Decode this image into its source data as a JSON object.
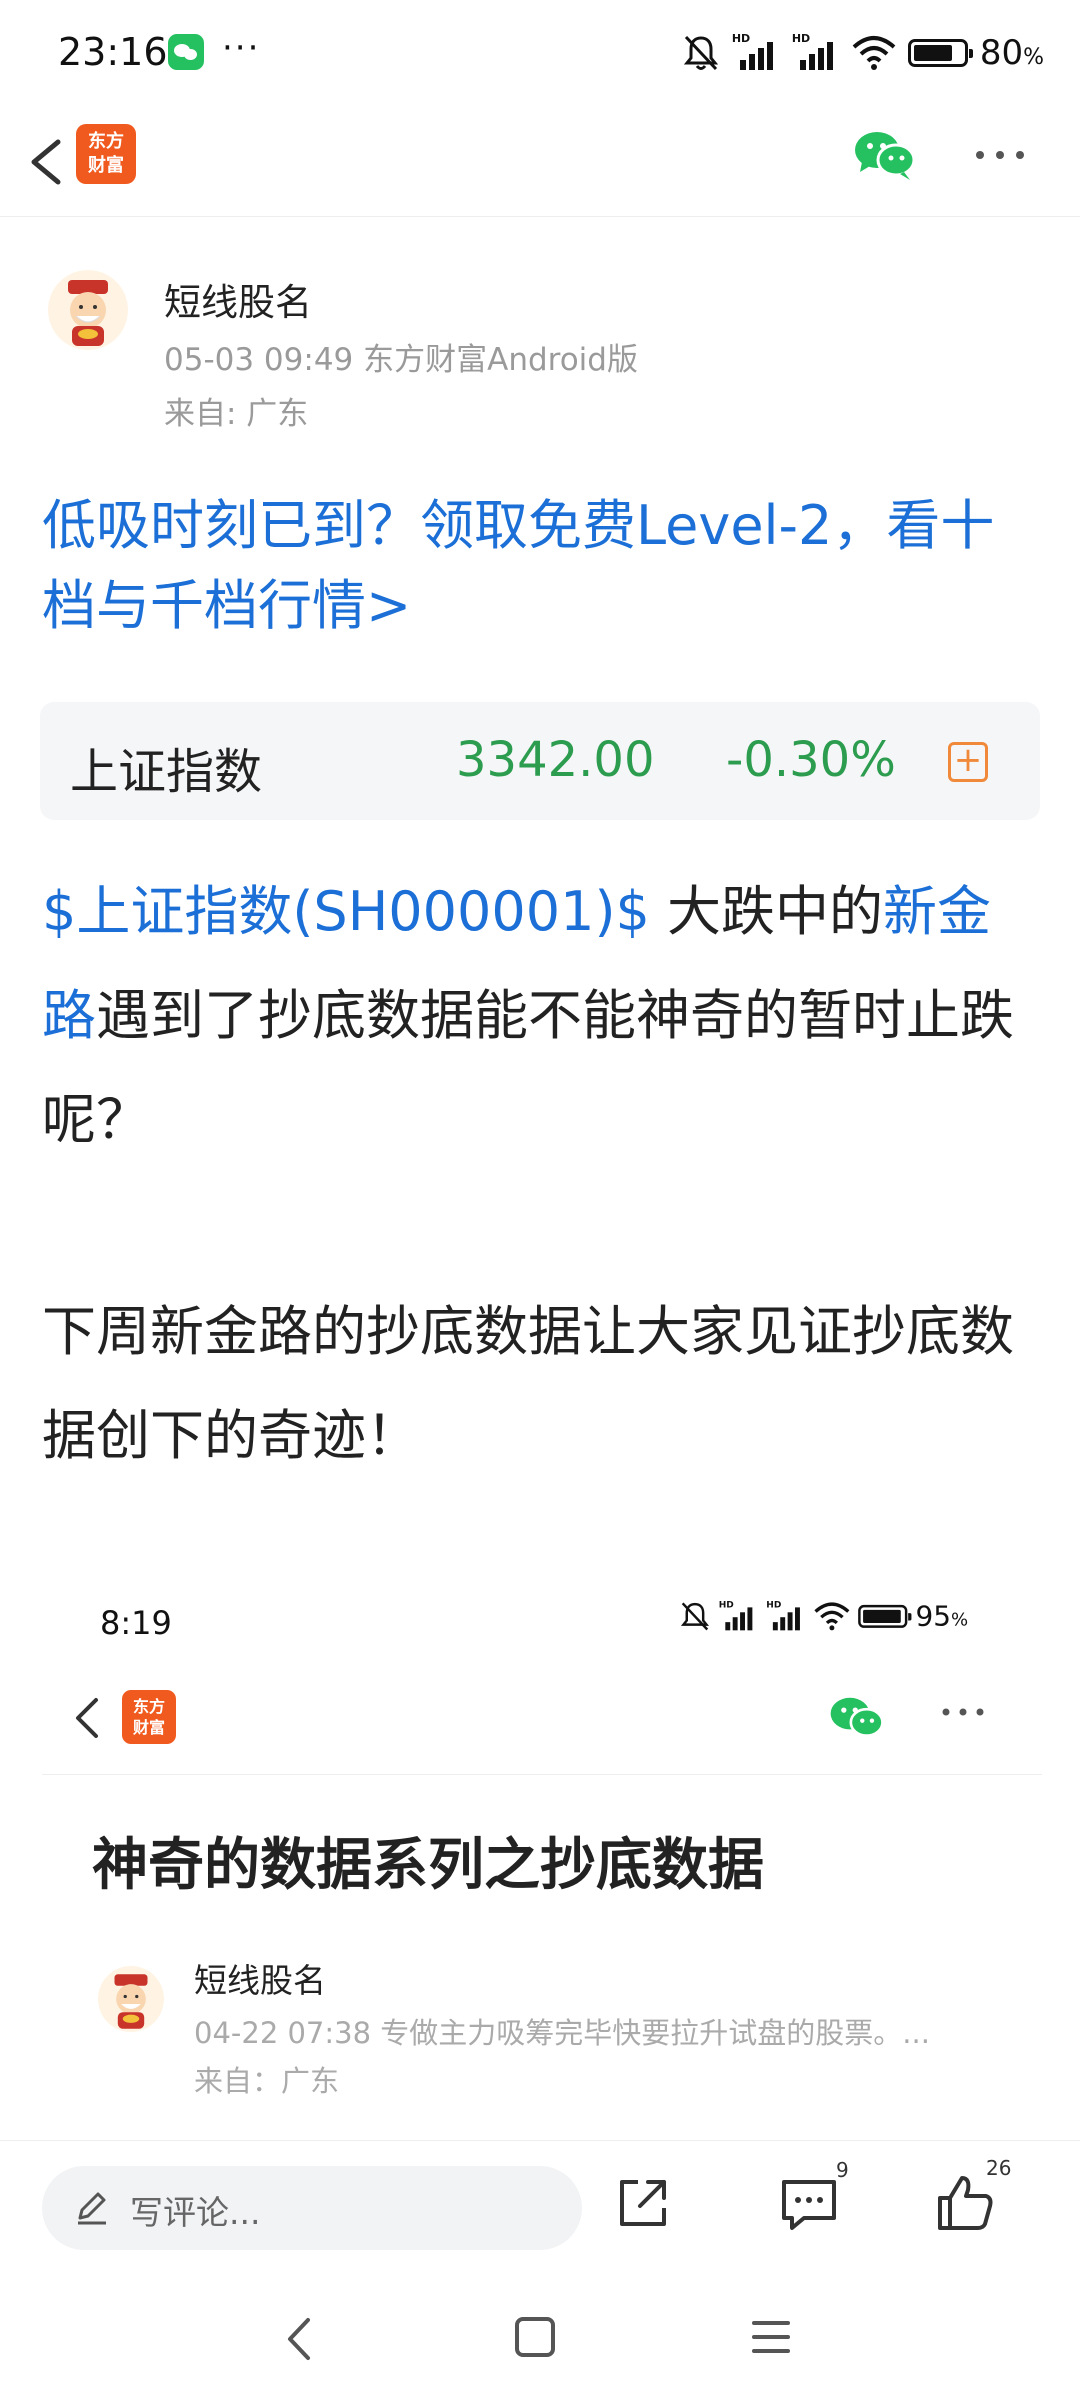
{
  "status_bar": {
    "time": "23:16",
    "overflow": "···",
    "signal_1": "HD",
    "signal_2": "HD",
    "battery": "80",
    "battery_unit": "%",
    "battery_level": 0.8
  },
  "nav": {
    "logo_line1": "东方",
    "logo_line2": "财富"
  },
  "author": {
    "name": "短线股名",
    "meta": "05-03 09:49 东方财富Android版",
    "location": "来自: 广东"
  },
  "promo": {
    "text": "低吸时刻已到？领取免费Level-2，看十档与千档行情>"
  },
  "stock": {
    "name": "上证指数",
    "price": "3342.00",
    "change": "-0.30%",
    "add_icon": "plus-square-icon",
    "change_color": "#2c9c4f"
  },
  "post": {
    "p1_link": "$上证指数(SH000001)$",
    "p1_text_a": " 大跌中的",
    "p1_link2": "新金路",
    "p1_text_b": "遇到了抄底数据能不能神奇的暂时止跌呢？",
    "p2": "下周新金路的抄底数据让大家见证抄底数据创下的奇迹！"
  },
  "embedded": {
    "time": "8:19",
    "signal_1": "HD",
    "signal_2": "HD",
    "battery": "95",
    "battery_unit": "%",
    "battery_level": 0.95,
    "logo_line1": "东方",
    "logo_line2": "财富",
    "title": "神奇的数据系列之抄底数据",
    "author_name": "短线股名",
    "meta": "04-22 07:38 专做主力吸筹完毕快要拉升试盘的股票。...",
    "location": "来自：广东"
  },
  "toolbar": {
    "comment_placeholder": "写评论...",
    "comment_count": "9",
    "like_count": "26"
  },
  "colors": {
    "link": "#1b6fd6",
    "stock_green": "#2c9c4f",
    "brand_orange": "#f05a1e",
    "wechat_green": "#25c160"
  }
}
